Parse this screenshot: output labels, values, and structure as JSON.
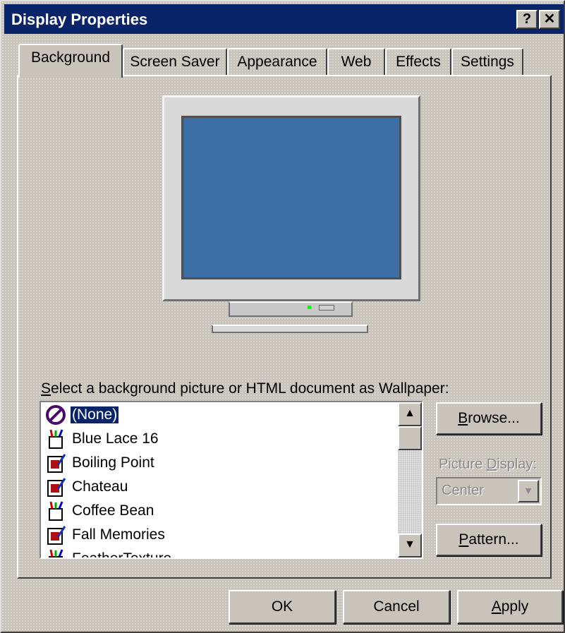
{
  "window": {
    "title": "Display Properties",
    "help_button": "?",
    "close_button": "✕"
  },
  "tabs": [
    {
      "label": "Background",
      "active": true
    },
    {
      "label": "Screen Saver",
      "active": false
    },
    {
      "label": "Appearance",
      "active": false
    },
    {
      "label": "Web",
      "active": false
    },
    {
      "label": "Effects",
      "active": false
    },
    {
      "label": "Settings",
      "active": false
    }
  ],
  "preview": {
    "screen_color": "#3a6ea5"
  },
  "wallpaper": {
    "label_accel": "S",
    "label_rest": "elect a background picture or HTML document as Wallpaper:",
    "items": [
      {
        "label": "(None)",
        "icon": "none-icon",
        "selected": true
      },
      {
        "label": "Blue Lace 16",
        "icon": "paint-icon",
        "selected": false
      },
      {
        "label": "Boiling Point",
        "icon": "html-document-icon",
        "selected": false
      },
      {
        "label": "Chateau",
        "icon": "html-document-icon",
        "selected": false
      },
      {
        "label": "Coffee Bean",
        "icon": "paint-icon",
        "selected": false
      },
      {
        "label": "Fall Memories",
        "icon": "html-document-icon",
        "selected": false
      },
      {
        "label": "FeatherTexture",
        "icon": "paint-icon",
        "selected": false
      }
    ],
    "scroll_up": "▲",
    "scroll_down": "▼"
  },
  "side": {
    "browse_accel": "B",
    "browse_rest": "rowse...",
    "picture_display_label_pre": "Picture ",
    "picture_display_accel": "D",
    "picture_display_label_post": "isplay:",
    "picture_display_value": "Center",
    "combo_arrow": "▼",
    "pattern_accel": "P",
    "pattern_rest": "attern..."
  },
  "footer": {
    "ok_label": "OK",
    "cancel_label": "Cancel",
    "apply_accel": "A",
    "apply_rest": "pply"
  },
  "colors": {
    "titlebar": "#0a246a",
    "selection": "#0a246a",
    "face": "#c8c4bc"
  }
}
